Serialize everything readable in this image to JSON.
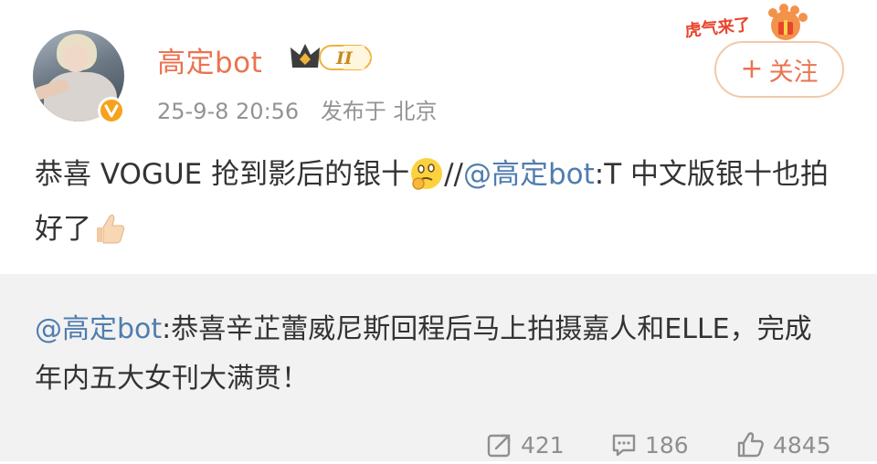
{
  "post": {
    "username": "高定bot",
    "level_badge": "II",
    "timestamp": "25-9-8 20:56",
    "location": "发布于 北京",
    "follow_label": "关注",
    "follow_plus": "+",
    "sticker_text": "虎气来了",
    "content": {
      "part1": "恭喜 VOGUE 抢到影后的银十",
      "separator": "//",
      "mention": "@高定bot",
      "part2": ":T 中文版银十也拍好了"
    }
  },
  "repost": {
    "mention": "@高定bot",
    "text": ":恭喜辛芷蕾威尼斯回程后马上拍摄嘉人和ELLE，完成年内五大女刊大满贯！"
  },
  "actions": {
    "reposts": "421",
    "comments": "186",
    "likes": "4845"
  },
  "colors": {
    "username": "#eb7350",
    "mention": "#507daf",
    "repost_bg": "#f2f2f2",
    "muted": "#939393"
  },
  "icons": {
    "verified": "v-badge-icon",
    "crown": "crown-level-icon",
    "repost": "share-icon",
    "comment": "comment-icon",
    "like": "thumbs-up-icon"
  }
}
